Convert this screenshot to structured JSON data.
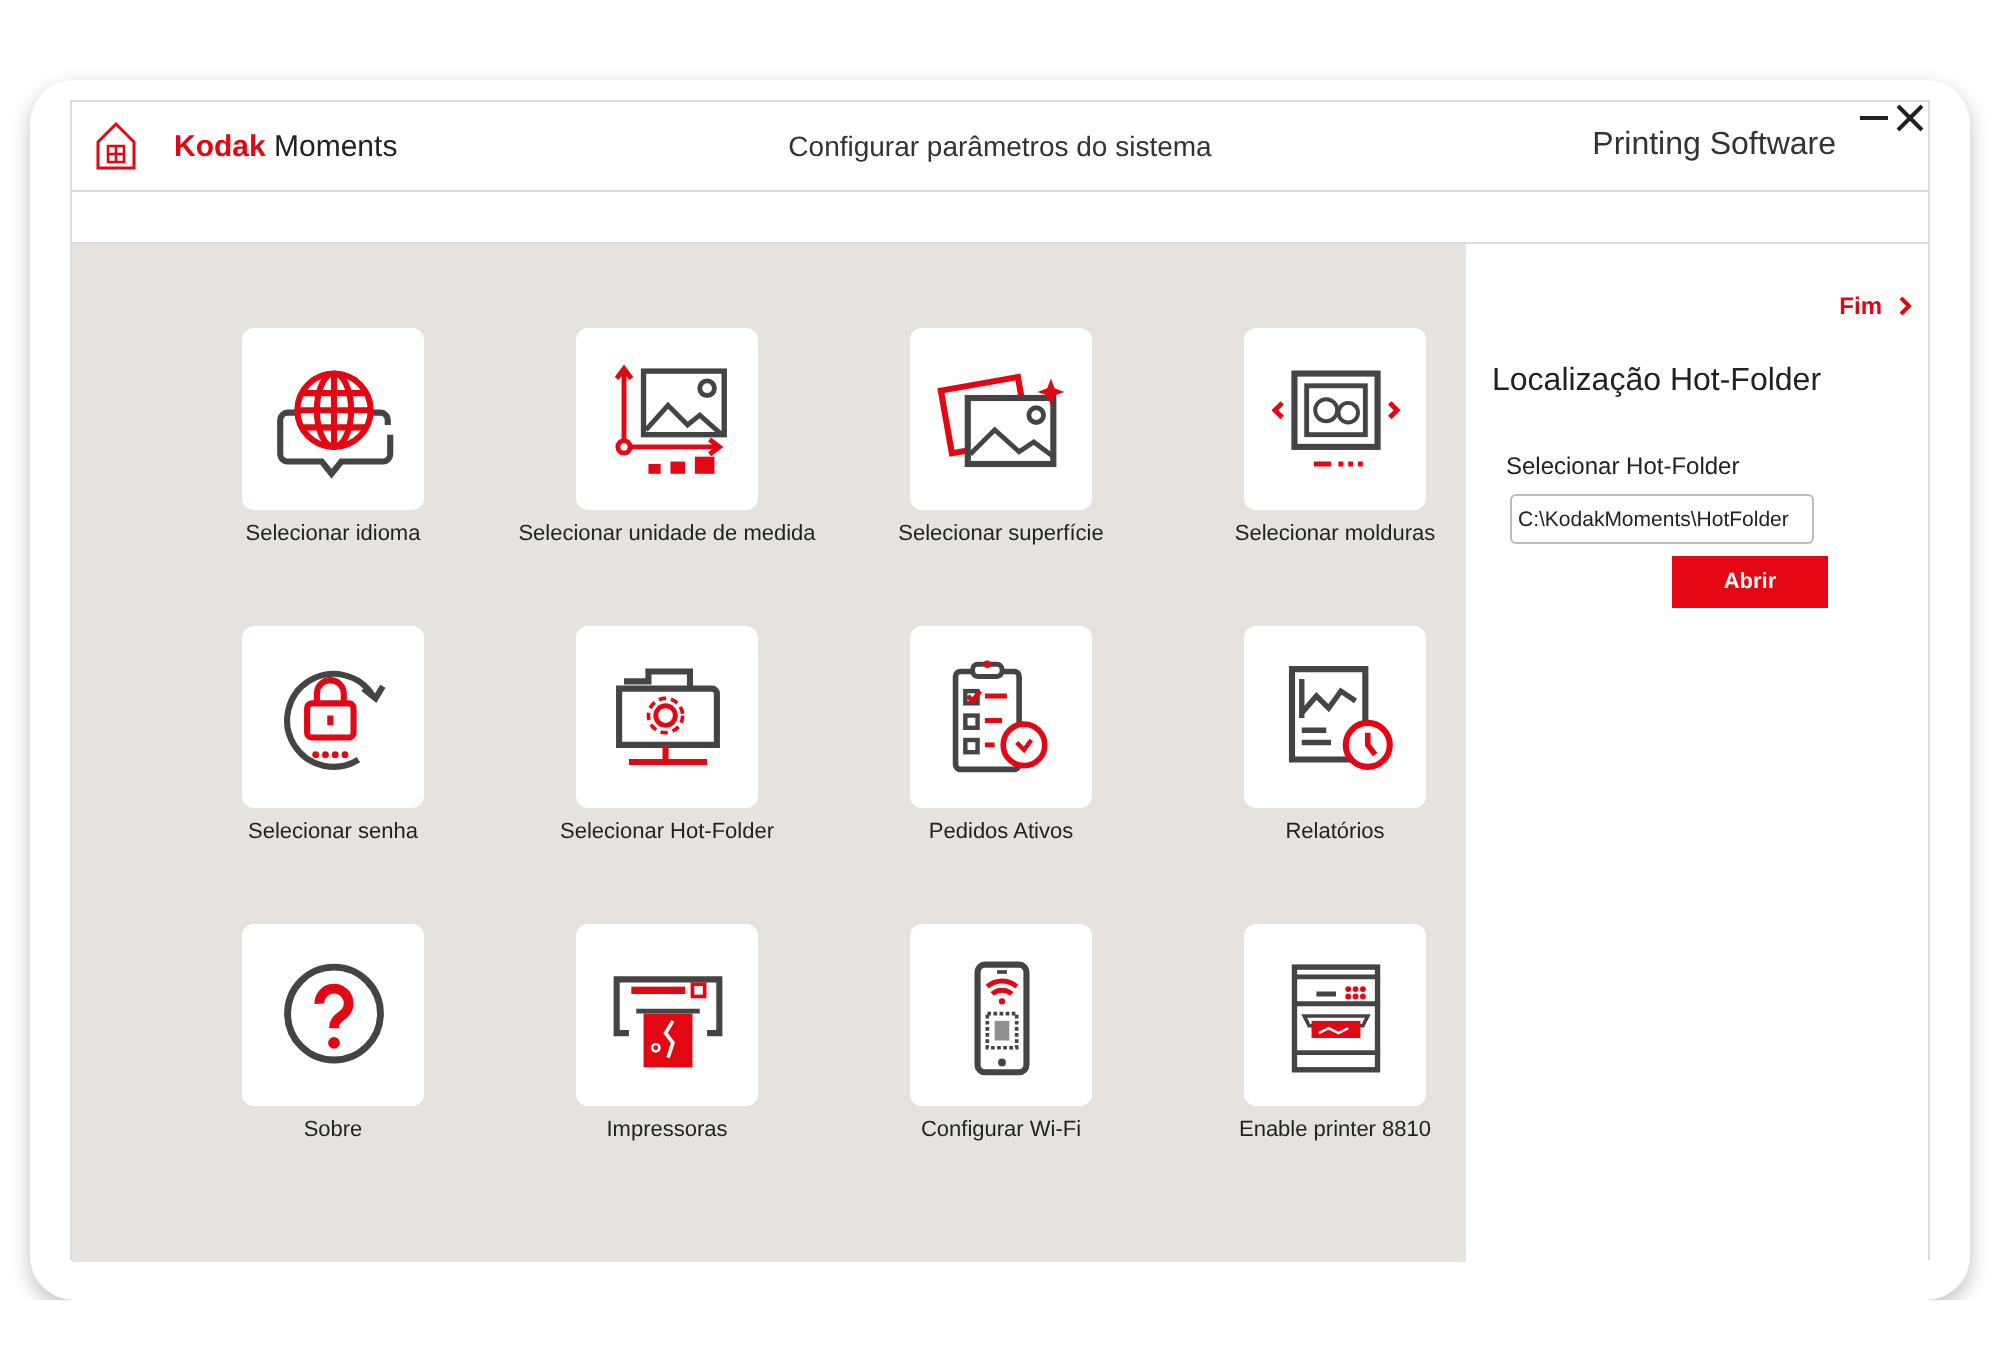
{
  "header": {
    "logo": "**Kodak** Moments",
    "title": "Configurar parâmetros do sistema",
    "product": "Printing Software"
  },
  "tiles": [
    {
      "label": "Selecionar idioma"
    },
    {
      "label": "Selecionar unidade de medida"
    },
    {
      "label": "Selecionar superfície"
    },
    {
      "label": "Selecionar molduras"
    },
    {
      "label": "Selecionar senha"
    },
    {
      "label": "Selecionar Hot-Folder"
    },
    {
      "label": "Pedidos Ativos"
    },
    {
      "label": "Relatórios"
    },
    {
      "label": "Sobre"
    },
    {
      "label": "Impressoras"
    },
    {
      "label": "Configurar Wi-Fi"
    },
    {
      "label": "Enable printer 8810"
    }
  ],
  "panel": {
    "finish_link": "Fim",
    "heading": "Localização Hot-Folder",
    "field_label": "Selecionar Hot-Folder",
    "field_value": "C:\\KodakMoments\\HotFolder",
    "button": "Abrir"
  }
}
